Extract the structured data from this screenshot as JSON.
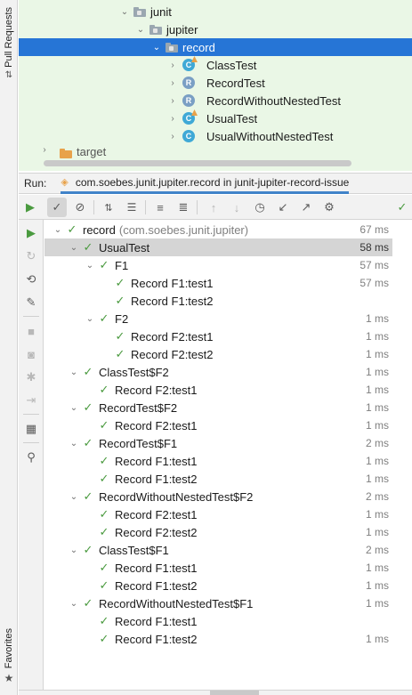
{
  "left_stripe": {
    "pull_requests": "Pull Requests",
    "favorites": "Favorites"
  },
  "project_tree": {
    "rows": [
      {
        "label": "junit",
        "kind": "package"
      },
      {
        "label": "jupiter",
        "kind": "package"
      },
      {
        "label": "record",
        "kind": "package",
        "selected": true
      },
      {
        "label": "ClassTest",
        "kind": "class-c"
      },
      {
        "label": "RecordTest",
        "kind": "class-r"
      },
      {
        "label": "RecordWithoutNestedTest",
        "kind": "class-r"
      },
      {
        "label": "UsualTest",
        "kind": "class-c"
      },
      {
        "label": "UsualWithoutNestedTest",
        "kind": "class-c"
      },
      {
        "label": "target",
        "kind": "folder"
      }
    ]
  },
  "run_bar": {
    "label": "Run:",
    "tab_label": "com.soebes.junit.jupiter.record in junit-jupiter-record-issue"
  },
  "tests": {
    "root": {
      "name": "record",
      "package": "(com.soebes.junit.jupiter)",
      "time": "67 ms"
    },
    "rows": [
      {
        "name": "UsualTest",
        "time": "58 ms",
        "selected": true
      },
      {
        "name": "F1",
        "time": "57 ms"
      },
      {
        "name": "Record F1:test1",
        "time": "57 ms"
      },
      {
        "name": "Record F1:test2",
        "time": ""
      },
      {
        "name": "F2",
        "time": "1 ms"
      },
      {
        "name": "Record F2:test1",
        "time": "1 ms"
      },
      {
        "name": "Record F2:test2",
        "time": "1 ms"
      },
      {
        "name": "ClassTest$F2",
        "time": "1 ms"
      },
      {
        "name": "Record F2:test1",
        "time": "1 ms"
      },
      {
        "name": "RecordTest$F2",
        "time": "1 ms"
      },
      {
        "name": "Record F2:test1",
        "time": "1 ms"
      },
      {
        "name": "RecordTest$F1",
        "time": "2 ms"
      },
      {
        "name": "Record F1:test1",
        "time": "1 ms"
      },
      {
        "name": "Record F1:test2",
        "time": "1 ms"
      },
      {
        "name": "RecordWithoutNestedTest$F2",
        "time": "2 ms"
      },
      {
        "name": "Record F2:test1",
        "time": "1 ms"
      },
      {
        "name": "Record F2:test2",
        "time": "1 ms"
      },
      {
        "name": "ClassTest$F1",
        "time": "2 ms"
      },
      {
        "name": "Record F1:test1",
        "time": "1 ms"
      },
      {
        "name": "Record F1:test2",
        "time": "1 ms"
      },
      {
        "name": "RecordWithoutNestedTest$F1",
        "time": "1 ms"
      },
      {
        "name": "Record F1:test1",
        "time": ""
      },
      {
        "name": "Record F1:test2",
        "time": "1 ms"
      }
    ]
  },
  "colors": {
    "selection_blue": "#2675d6",
    "project_bg": "#eaf7e6",
    "pass_green": "#4a9a3f",
    "row_selected": "#d5d5d5"
  }
}
